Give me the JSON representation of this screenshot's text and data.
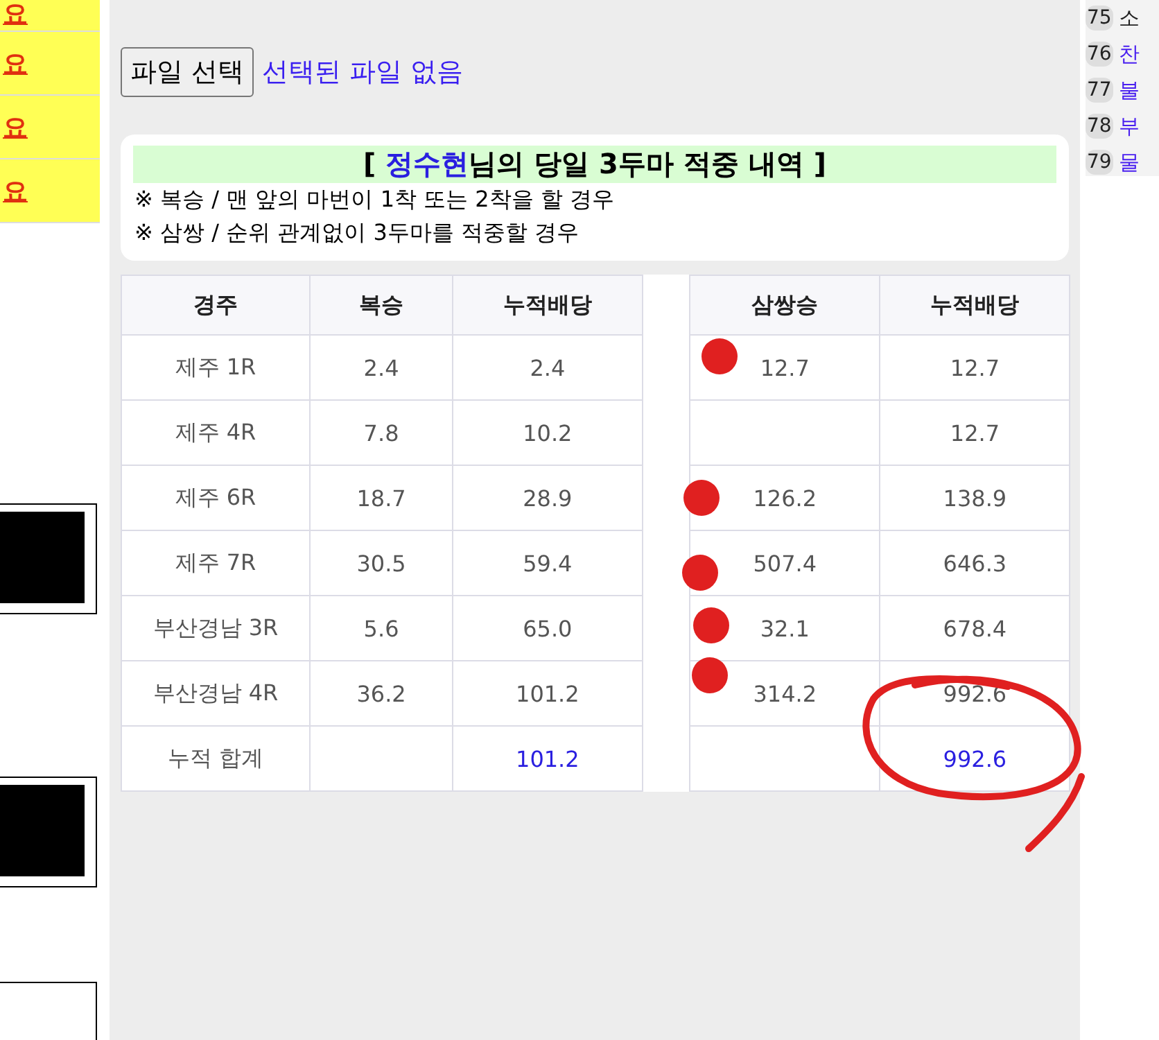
{
  "left_links": [
    {
      "label": "요"
    },
    {
      "label": "요"
    },
    {
      "label": "요"
    },
    {
      "label": "요"
    }
  ],
  "file_input": {
    "button": "파일 선택",
    "status": "선택된 파일 없음"
  },
  "summary": {
    "title_open": "[",
    "name": "정수현",
    "title_rest": "님의 당일 3두마 적중 내역 ]",
    "notes": [
      "※ 복승 / 맨 앞의 마번이 1착 또는 2착을 할 경우",
      "※ 삼쌍 / 순위 관계없이 3두마를 적중할 경우"
    ]
  },
  "table": {
    "columns_left": [
      "경주",
      "복승",
      "누적배당"
    ],
    "columns_right": [
      "삼쌍승",
      "누적배당"
    ],
    "rows": [
      {
        "kind": "race",
        "race": "제주 1R",
        "quinella": "2.4",
        "quinella_total": "2.4",
        "trifecta": "12.7",
        "trifecta_total": "12.7"
      },
      {
        "kind": "race",
        "race": "제주 4R",
        "quinella": "7.8",
        "quinella_total": "10.2",
        "trifecta": "",
        "trifecta_total": "12.7"
      },
      {
        "kind": "race",
        "race": "제주 6R",
        "quinella": "18.7",
        "quinella_total": "28.9",
        "trifecta": "126.2",
        "trifecta_total": "138.9"
      },
      {
        "kind": "race",
        "race": "제주 7R",
        "quinella": "30.5",
        "quinella_total": "59.4",
        "trifecta": "507.4",
        "trifecta_total": "646.3"
      },
      {
        "kind": "race",
        "race": "부산경남 3R",
        "quinella": "5.6",
        "quinella_total": "65.0",
        "trifecta": "32.1",
        "trifecta_total": "678.4"
      },
      {
        "kind": "race",
        "race": "부산경남 4R",
        "quinella": "36.2",
        "quinella_total": "101.2",
        "trifecta": "314.2",
        "trifecta_total": "992.6"
      },
      {
        "kind": "total",
        "race": "누적 합계",
        "quinella": "",
        "quinella_total": "101.2",
        "trifecta": "",
        "trifecta_total": "992.6"
      }
    ]
  },
  "side_list": [
    {
      "number": "75",
      "text": "소",
      "kind": "plain"
    },
    {
      "number": "76",
      "text": "찬",
      "kind": "link"
    },
    {
      "number": "77",
      "text": "불",
      "kind": "link"
    },
    {
      "number": "78",
      "text": "부",
      "kind": "link"
    },
    {
      "number": "79",
      "text": "물",
      "kind": "link"
    }
  ]
}
